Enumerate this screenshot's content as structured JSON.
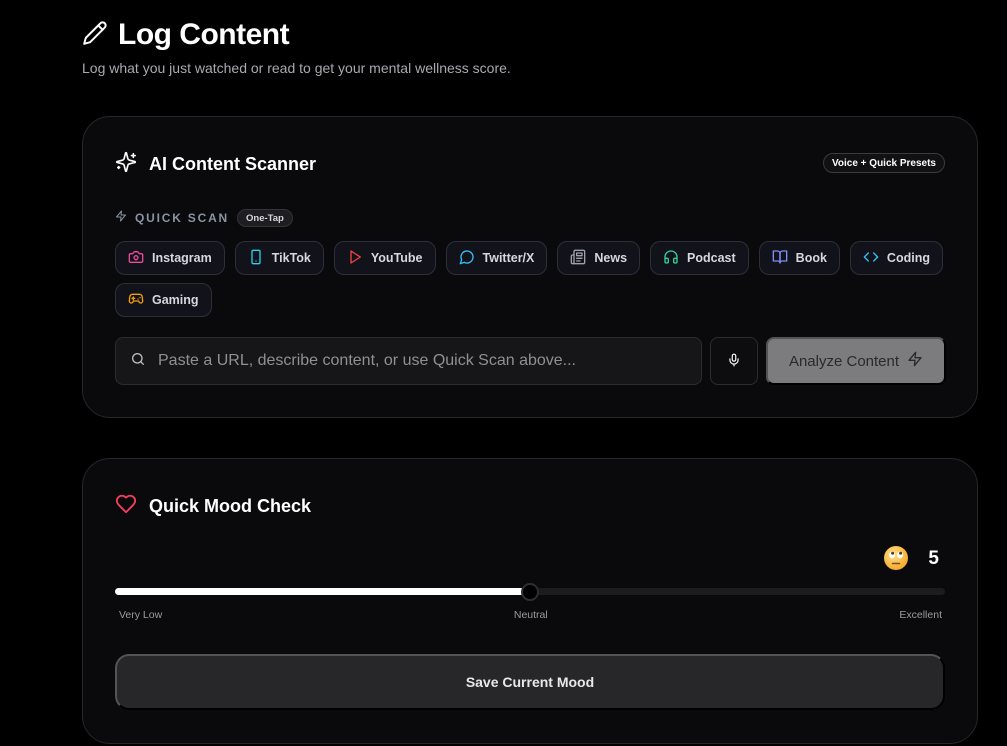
{
  "header": {
    "title": "Log Content",
    "subtitle": "Log what you just watched or read to get your mental wellness score."
  },
  "scanner": {
    "title": "AI Content Scanner",
    "badge": "Voice + Quick Presets",
    "quick_scan_label": "QUICK SCAN",
    "quick_scan_badge": "One-Tap",
    "presets": [
      {
        "label": "Instagram",
        "icon": "camera-icon",
        "color": "#ec4899"
      },
      {
        "label": "TikTok",
        "icon": "phone-icon",
        "color": "#22d3ee"
      },
      {
        "label": "YouTube",
        "icon": "play-icon",
        "color": "#ef4444"
      },
      {
        "label": "Twitter/X",
        "icon": "chat-bubble-icon",
        "color": "#38bdf8"
      },
      {
        "label": "News",
        "icon": "newspaper-icon",
        "color": "#9ca3af"
      },
      {
        "label": "Podcast",
        "icon": "headphones-icon",
        "color": "#34d399"
      },
      {
        "label": "Book",
        "icon": "book-icon",
        "color": "#818cf8"
      },
      {
        "label": "Coding",
        "icon": "code-icon",
        "color": "#38bdf8"
      },
      {
        "label": "Gaming",
        "icon": "gamepad-icon",
        "color": "#f59e0b"
      }
    ],
    "search_placeholder": "Paste a URL, describe content, or use Quick Scan above...",
    "analyze_label": "Analyze Content"
  },
  "mood": {
    "title": "Quick Mood Check",
    "value": "5",
    "min": 0,
    "max": 10,
    "emoji": "eye-roll-emoji",
    "scale_low": "Very Low",
    "scale_mid": "Neutral",
    "scale_high": "Excellent",
    "save_label": "Save Current Mood"
  },
  "colors": {
    "accent_heart": "#f43f5e",
    "analyze_bg": "#7c7c7e"
  }
}
